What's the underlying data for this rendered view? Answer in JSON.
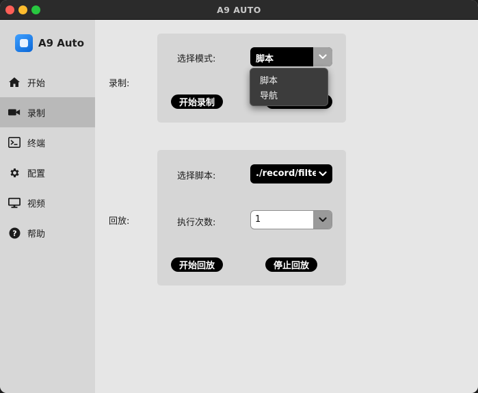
{
  "window": {
    "title": "A9 AUTO"
  },
  "brand": {
    "name": "A9 Auto"
  },
  "sidebar": {
    "items": [
      {
        "label": "开始",
        "icon": "home-icon"
      },
      {
        "label": "录制",
        "icon": "video-camera-icon",
        "active": true
      },
      {
        "label": "终端",
        "icon": "terminal-icon"
      },
      {
        "label": "配置",
        "icon": "gear-icon"
      },
      {
        "label": "视频",
        "icon": "monitor-icon"
      },
      {
        "label": "帮助",
        "icon": "help-icon"
      }
    ]
  },
  "record": {
    "section_label": "录制:",
    "mode_label": "选择模式:",
    "mode_value": "脚本",
    "mode_options": [
      "脚本",
      "导航"
    ],
    "start_button": "开始录制"
  },
  "playback": {
    "section_label": "回放:",
    "script_label": "选择脚本:",
    "script_value": "./record/filtered",
    "count_label": "执行次数:",
    "count_value": "1",
    "start_button": "开始回放",
    "stop_button": "停止回放"
  },
  "colors": {
    "accent": "#0a84ff",
    "active_nav": "#b9b9b9",
    "button": "#000000"
  }
}
